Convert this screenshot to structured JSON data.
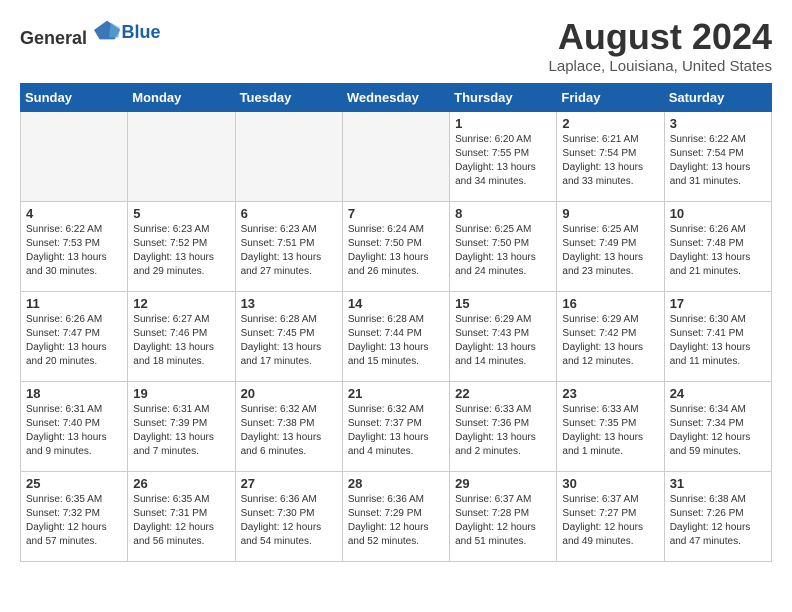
{
  "header": {
    "logo_general": "General",
    "logo_blue": "Blue",
    "month_year": "August 2024",
    "location": "Laplace, Louisiana, United States"
  },
  "days_of_week": [
    "Sunday",
    "Monday",
    "Tuesday",
    "Wednesday",
    "Thursday",
    "Friday",
    "Saturday"
  ],
  "weeks": [
    [
      {
        "day": "",
        "info": ""
      },
      {
        "day": "",
        "info": ""
      },
      {
        "day": "",
        "info": ""
      },
      {
        "day": "",
        "info": ""
      },
      {
        "day": "1",
        "info": "Sunrise: 6:20 AM\nSunset: 7:55 PM\nDaylight: 13 hours\nand 34 minutes."
      },
      {
        "day": "2",
        "info": "Sunrise: 6:21 AM\nSunset: 7:54 PM\nDaylight: 13 hours\nand 33 minutes."
      },
      {
        "day": "3",
        "info": "Sunrise: 6:22 AM\nSunset: 7:54 PM\nDaylight: 13 hours\nand 31 minutes."
      }
    ],
    [
      {
        "day": "4",
        "info": "Sunrise: 6:22 AM\nSunset: 7:53 PM\nDaylight: 13 hours\nand 30 minutes."
      },
      {
        "day": "5",
        "info": "Sunrise: 6:23 AM\nSunset: 7:52 PM\nDaylight: 13 hours\nand 29 minutes."
      },
      {
        "day": "6",
        "info": "Sunrise: 6:23 AM\nSunset: 7:51 PM\nDaylight: 13 hours\nand 27 minutes."
      },
      {
        "day": "7",
        "info": "Sunrise: 6:24 AM\nSunset: 7:50 PM\nDaylight: 13 hours\nand 26 minutes."
      },
      {
        "day": "8",
        "info": "Sunrise: 6:25 AM\nSunset: 7:50 PM\nDaylight: 13 hours\nand 24 minutes."
      },
      {
        "day": "9",
        "info": "Sunrise: 6:25 AM\nSunset: 7:49 PM\nDaylight: 13 hours\nand 23 minutes."
      },
      {
        "day": "10",
        "info": "Sunrise: 6:26 AM\nSunset: 7:48 PM\nDaylight: 13 hours\nand 21 minutes."
      }
    ],
    [
      {
        "day": "11",
        "info": "Sunrise: 6:26 AM\nSunset: 7:47 PM\nDaylight: 13 hours\nand 20 minutes."
      },
      {
        "day": "12",
        "info": "Sunrise: 6:27 AM\nSunset: 7:46 PM\nDaylight: 13 hours\nand 18 minutes."
      },
      {
        "day": "13",
        "info": "Sunrise: 6:28 AM\nSunset: 7:45 PM\nDaylight: 13 hours\nand 17 minutes."
      },
      {
        "day": "14",
        "info": "Sunrise: 6:28 AM\nSunset: 7:44 PM\nDaylight: 13 hours\nand 15 minutes."
      },
      {
        "day": "15",
        "info": "Sunrise: 6:29 AM\nSunset: 7:43 PM\nDaylight: 13 hours\nand 14 minutes."
      },
      {
        "day": "16",
        "info": "Sunrise: 6:29 AM\nSunset: 7:42 PM\nDaylight: 13 hours\nand 12 minutes."
      },
      {
        "day": "17",
        "info": "Sunrise: 6:30 AM\nSunset: 7:41 PM\nDaylight: 13 hours\nand 11 minutes."
      }
    ],
    [
      {
        "day": "18",
        "info": "Sunrise: 6:31 AM\nSunset: 7:40 PM\nDaylight: 13 hours\nand 9 minutes."
      },
      {
        "day": "19",
        "info": "Sunrise: 6:31 AM\nSunset: 7:39 PM\nDaylight: 13 hours\nand 7 minutes."
      },
      {
        "day": "20",
        "info": "Sunrise: 6:32 AM\nSunset: 7:38 PM\nDaylight: 13 hours\nand 6 minutes."
      },
      {
        "day": "21",
        "info": "Sunrise: 6:32 AM\nSunset: 7:37 PM\nDaylight: 13 hours\nand 4 minutes."
      },
      {
        "day": "22",
        "info": "Sunrise: 6:33 AM\nSunset: 7:36 PM\nDaylight: 13 hours\nand 2 minutes."
      },
      {
        "day": "23",
        "info": "Sunrise: 6:33 AM\nSunset: 7:35 PM\nDaylight: 13 hours\nand 1 minute."
      },
      {
        "day": "24",
        "info": "Sunrise: 6:34 AM\nSunset: 7:34 PM\nDaylight: 12 hours\nand 59 minutes."
      }
    ],
    [
      {
        "day": "25",
        "info": "Sunrise: 6:35 AM\nSunset: 7:32 PM\nDaylight: 12 hours\nand 57 minutes."
      },
      {
        "day": "26",
        "info": "Sunrise: 6:35 AM\nSunset: 7:31 PM\nDaylight: 12 hours\nand 56 minutes."
      },
      {
        "day": "27",
        "info": "Sunrise: 6:36 AM\nSunset: 7:30 PM\nDaylight: 12 hours\nand 54 minutes."
      },
      {
        "day": "28",
        "info": "Sunrise: 6:36 AM\nSunset: 7:29 PM\nDaylight: 12 hours\nand 52 minutes."
      },
      {
        "day": "29",
        "info": "Sunrise: 6:37 AM\nSunset: 7:28 PM\nDaylight: 12 hours\nand 51 minutes."
      },
      {
        "day": "30",
        "info": "Sunrise: 6:37 AM\nSunset: 7:27 PM\nDaylight: 12 hours\nand 49 minutes."
      },
      {
        "day": "31",
        "info": "Sunrise: 6:38 AM\nSunset: 7:26 PM\nDaylight: 12 hours\nand 47 minutes."
      }
    ]
  ]
}
